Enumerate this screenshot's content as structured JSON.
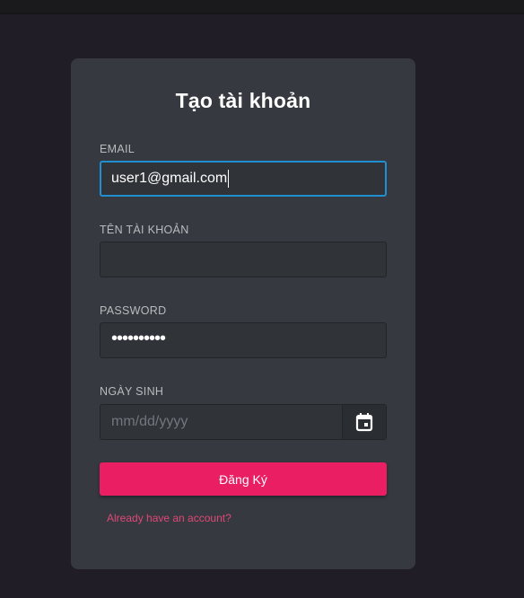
{
  "form": {
    "title": "Tạo tài khoản",
    "email": {
      "label": "EMAIL",
      "value": "user1@gmail.com"
    },
    "username": {
      "label": "TÊN TÀI KHOẢN",
      "value": ""
    },
    "password": {
      "label": "PASSWORD",
      "masked_value": "••••••••••"
    },
    "birthdate": {
      "label": "NGÀY SINH",
      "placeholder": "mm/dd/yyyy",
      "icon": "calendar-icon"
    },
    "submit_label": "Đăng Ký",
    "login_link": "Already have an account?"
  },
  "colors": {
    "background": "#211d27",
    "card": "#36393f",
    "input": "#303338",
    "accent": "#e91e63",
    "focus": "#1f8fcf",
    "link": "#e04878"
  }
}
